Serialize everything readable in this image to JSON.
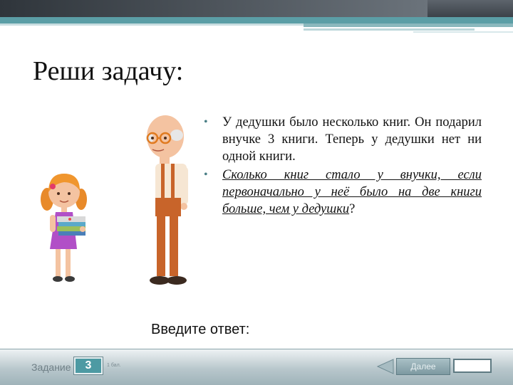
{
  "slide": {
    "title": "Реши задачу:",
    "task_text": "У дедушки было несколько книг. Он подарил внучке 3 книги. Теперь у дедушки нет ни одной книги.",
    "question_text": "Сколько книг стало у внучки, если первоначально у неё было на две книги больше, чем у дедушки",
    "question_mark": "?",
    "answer_prompt": "Введите ответ:"
  },
  "footer": {
    "task_label": "Задание",
    "task_number": "3",
    "points_label": "1 бал.",
    "next_label": "Далее",
    "answer_value": ""
  },
  "colors": {
    "accent": "#4d9aa3",
    "top_bar": "#3c4249",
    "stripe": "#5b9ea6"
  },
  "icons": [
    "girl-with-books-illustration",
    "grandfather-illustration",
    "back-arrow-icon"
  ]
}
